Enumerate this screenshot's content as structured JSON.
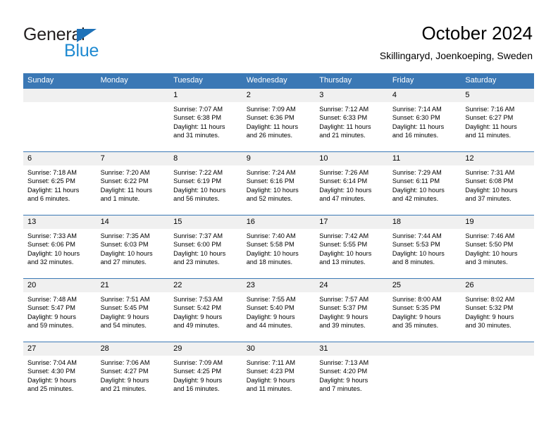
{
  "brand": {
    "name_top": "General",
    "name_bottom": "Blue",
    "colors": {
      "dark": "#231f20",
      "blue": "#1f8ad1",
      "triangle": "#1f72b8"
    }
  },
  "header": {
    "title": "October 2024",
    "subtitle": "Skillingaryd, Joenkoeping, Sweden"
  },
  "theme": {
    "header_row_bg": "#3b78b5",
    "day_number_bg": "#f0f0f0",
    "cell_bg": "#ffffff",
    "text": "#000000"
  },
  "weekdays": [
    "Sunday",
    "Monday",
    "Tuesday",
    "Wednesday",
    "Thursday",
    "Friday",
    "Saturday"
  ],
  "weeks": [
    [
      {
        "day": "",
        "sunrise": "",
        "sunset": "",
        "daylight_1": "",
        "daylight_2": ""
      },
      {
        "day": "",
        "sunrise": "",
        "sunset": "",
        "daylight_1": "",
        "daylight_2": ""
      },
      {
        "day": "1",
        "sunrise": "Sunrise: 7:07 AM",
        "sunset": "Sunset: 6:38 PM",
        "daylight_1": "Daylight: 11 hours",
        "daylight_2": "and 31 minutes."
      },
      {
        "day": "2",
        "sunrise": "Sunrise: 7:09 AM",
        "sunset": "Sunset: 6:36 PM",
        "daylight_1": "Daylight: 11 hours",
        "daylight_2": "and 26 minutes."
      },
      {
        "day": "3",
        "sunrise": "Sunrise: 7:12 AM",
        "sunset": "Sunset: 6:33 PM",
        "daylight_1": "Daylight: 11 hours",
        "daylight_2": "and 21 minutes."
      },
      {
        "day": "4",
        "sunrise": "Sunrise: 7:14 AM",
        "sunset": "Sunset: 6:30 PM",
        "daylight_1": "Daylight: 11 hours",
        "daylight_2": "and 16 minutes."
      },
      {
        "day": "5",
        "sunrise": "Sunrise: 7:16 AM",
        "sunset": "Sunset: 6:27 PM",
        "daylight_1": "Daylight: 11 hours",
        "daylight_2": "and 11 minutes."
      }
    ],
    [
      {
        "day": "6",
        "sunrise": "Sunrise: 7:18 AM",
        "sunset": "Sunset: 6:25 PM",
        "daylight_1": "Daylight: 11 hours",
        "daylight_2": "and 6 minutes."
      },
      {
        "day": "7",
        "sunrise": "Sunrise: 7:20 AM",
        "sunset": "Sunset: 6:22 PM",
        "daylight_1": "Daylight: 11 hours",
        "daylight_2": "and 1 minute."
      },
      {
        "day": "8",
        "sunrise": "Sunrise: 7:22 AM",
        "sunset": "Sunset: 6:19 PM",
        "daylight_1": "Daylight: 10 hours",
        "daylight_2": "and 56 minutes."
      },
      {
        "day": "9",
        "sunrise": "Sunrise: 7:24 AM",
        "sunset": "Sunset: 6:16 PM",
        "daylight_1": "Daylight: 10 hours",
        "daylight_2": "and 52 minutes."
      },
      {
        "day": "10",
        "sunrise": "Sunrise: 7:26 AM",
        "sunset": "Sunset: 6:14 PM",
        "daylight_1": "Daylight: 10 hours",
        "daylight_2": "and 47 minutes."
      },
      {
        "day": "11",
        "sunrise": "Sunrise: 7:29 AM",
        "sunset": "Sunset: 6:11 PM",
        "daylight_1": "Daylight: 10 hours",
        "daylight_2": "and 42 minutes."
      },
      {
        "day": "12",
        "sunrise": "Sunrise: 7:31 AM",
        "sunset": "Sunset: 6:08 PM",
        "daylight_1": "Daylight: 10 hours",
        "daylight_2": "and 37 minutes."
      }
    ],
    [
      {
        "day": "13",
        "sunrise": "Sunrise: 7:33 AM",
        "sunset": "Sunset: 6:06 PM",
        "daylight_1": "Daylight: 10 hours",
        "daylight_2": "and 32 minutes."
      },
      {
        "day": "14",
        "sunrise": "Sunrise: 7:35 AM",
        "sunset": "Sunset: 6:03 PM",
        "daylight_1": "Daylight: 10 hours",
        "daylight_2": "and 27 minutes."
      },
      {
        "day": "15",
        "sunrise": "Sunrise: 7:37 AM",
        "sunset": "Sunset: 6:00 PM",
        "daylight_1": "Daylight: 10 hours",
        "daylight_2": "and 23 minutes."
      },
      {
        "day": "16",
        "sunrise": "Sunrise: 7:40 AM",
        "sunset": "Sunset: 5:58 PM",
        "daylight_1": "Daylight: 10 hours",
        "daylight_2": "and 18 minutes."
      },
      {
        "day": "17",
        "sunrise": "Sunrise: 7:42 AM",
        "sunset": "Sunset: 5:55 PM",
        "daylight_1": "Daylight: 10 hours",
        "daylight_2": "and 13 minutes."
      },
      {
        "day": "18",
        "sunrise": "Sunrise: 7:44 AM",
        "sunset": "Sunset: 5:53 PM",
        "daylight_1": "Daylight: 10 hours",
        "daylight_2": "and 8 minutes."
      },
      {
        "day": "19",
        "sunrise": "Sunrise: 7:46 AM",
        "sunset": "Sunset: 5:50 PM",
        "daylight_1": "Daylight: 10 hours",
        "daylight_2": "and 3 minutes."
      }
    ],
    [
      {
        "day": "20",
        "sunrise": "Sunrise: 7:48 AM",
        "sunset": "Sunset: 5:47 PM",
        "daylight_1": "Daylight: 9 hours",
        "daylight_2": "and 59 minutes."
      },
      {
        "day": "21",
        "sunrise": "Sunrise: 7:51 AM",
        "sunset": "Sunset: 5:45 PM",
        "daylight_1": "Daylight: 9 hours",
        "daylight_2": "and 54 minutes."
      },
      {
        "day": "22",
        "sunrise": "Sunrise: 7:53 AM",
        "sunset": "Sunset: 5:42 PM",
        "daylight_1": "Daylight: 9 hours",
        "daylight_2": "and 49 minutes."
      },
      {
        "day": "23",
        "sunrise": "Sunrise: 7:55 AM",
        "sunset": "Sunset: 5:40 PM",
        "daylight_1": "Daylight: 9 hours",
        "daylight_2": "and 44 minutes."
      },
      {
        "day": "24",
        "sunrise": "Sunrise: 7:57 AM",
        "sunset": "Sunset: 5:37 PM",
        "daylight_1": "Daylight: 9 hours",
        "daylight_2": "and 39 minutes."
      },
      {
        "day": "25",
        "sunrise": "Sunrise: 8:00 AM",
        "sunset": "Sunset: 5:35 PM",
        "daylight_1": "Daylight: 9 hours",
        "daylight_2": "and 35 minutes."
      },
      {
        "day": "26",
        "sunrise": "Sunrise: 8:02 AM",
        "sunset": "Sunset: 5:32 PM",
        "daylight_1": "Daylight: 9 hours",
        "daylight_2": "and 30 minutes."
      }
    ],
    [
      {
        "day": "27",
        "sunrise": "Sunrise: 7:04 AM",
        "sunset": "Sunset: 4:30 PM",
        "daylight_1": "Daylight: 9 hours",
        "daylight_2": "and 25 minutes."
      },
      {
        "day": "28",
        "sunrise": "Sunrise: 7:06 AM",
        "sunset": "Sunset: 4:27 PM",
        "daylight_1": "Daylight: 9 hours",
        "daylight_2": "and 21 minutes."
      },
      {
        "day": "29",
        "sunrise": "Sunrise: 7:09 AM",
        "sunset": "Sunset: 4:25 PM",
        "daylight_1": "Daylight: 9 hours",
        "daylight_2": "and 16 minutes."
      },
      {
        "day": "30",
        "sunrise": "Sunrise: 7:11 AM",
        "sunset": "Sunset: 4:23 PM",
        "daylight_1": "Daylight: 9 hours",
        "daylight_2": "and 11 minutes."
      },
      {
        "day": "31",
        "sunrise": "Sunrise: 7:13 AM",
        "sunset": "Sunset: 4:20 PM",
        "daylight_1": "Daylight: 9 hours",
        "daylight_2": "and 7 minutes."
      },
      {
        "day": "",
        "sunrise": "",
        "sunset": "",
        "daylight_1": "",
        "daylight_2": ""
      },
      {
        "day": "",
        "sunrise": "",
        "sunset": "",
        "daylight_1": "",
        "daylight_2": ""
      }
    ]
  ]
}
